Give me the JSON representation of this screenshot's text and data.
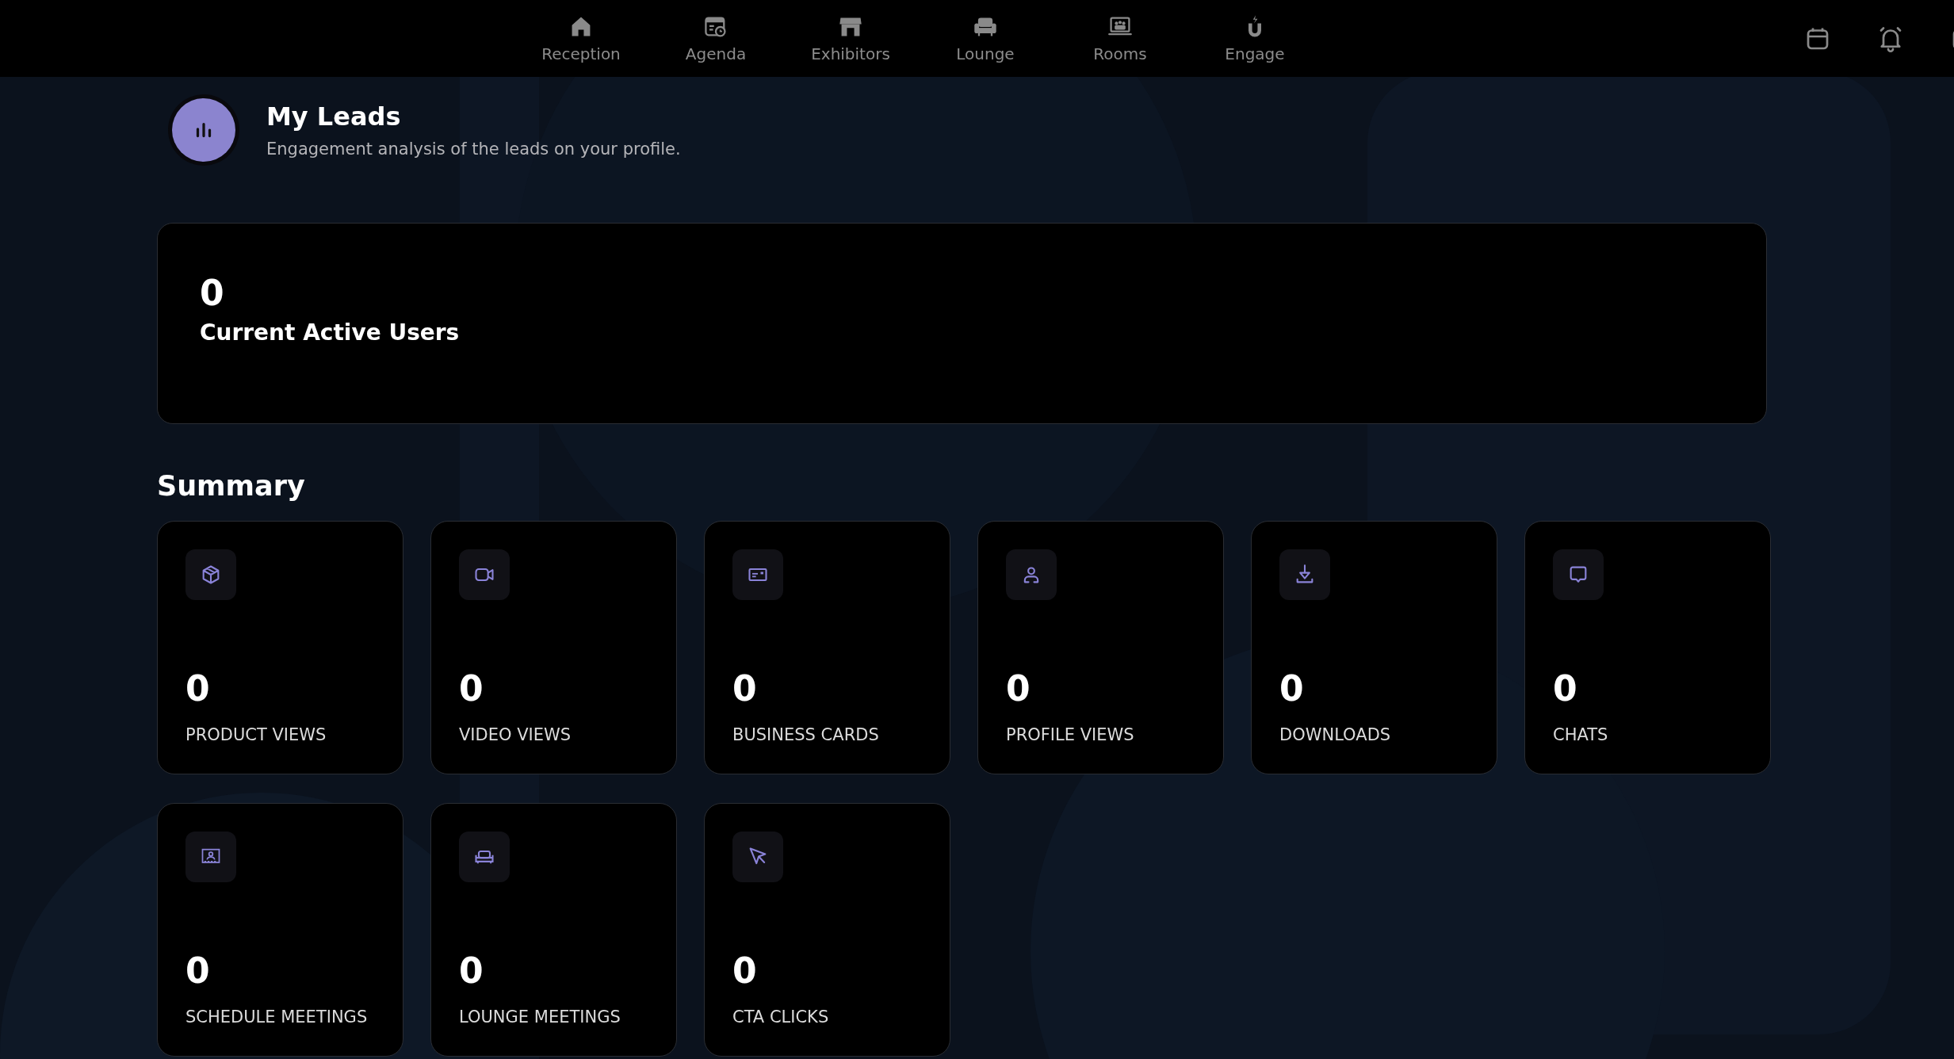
{
  "nav": [
    {
      "label": "Reception"
    },
    {
      "label": "Agenda"
    },
    {
      "label": "Exhibitors"
    },
    {
      "label": "Lounge"
    },
    {
      "label": "Rooms"
    },
    {
      "label": "Engage"
    }
  ],
  "header": {
    "title": "My Leads",
    "subtitle": "Engagement analysis of the leads on your profile."
  },
  "active_users": {
    "value": "0",
    "label": "Current Active Users"
  },
  "summary": {
    "title": "Summary",
    "cards": [
      {
        "value": "0",
        "label": "PRODUCT VIEWS"
      },
      {
        "value": "0",
        "label": "VIDEO VIEWS"
      },
      {
        "value": "0",
        "label": "BUSINESS CARDS"
      },
      {
        "value": "0",
        "label": "PROFILE VIEWS"
      },
      {
        "value": "0",
        "label": "DOWNLOADS"
      },
      {
        "value": "0",
        "label": "CHATS"
      },
      {
        "value": "0",
        "label": "SCHEDULE MEETINGS"
      },
      {
        "value": "0",
        "label": "LOUNGE MEETINGS"
      },
      {
        "value": "0",
        "label": "CTA CLICKS"
      }
    ]
  }
}
